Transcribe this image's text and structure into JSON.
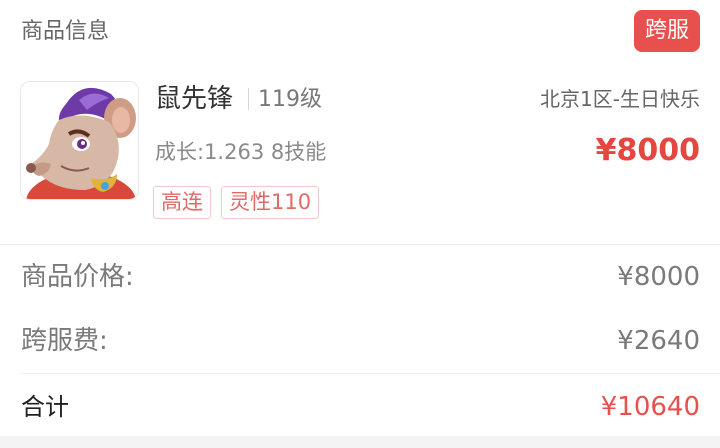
{
  "header": {
    "title": "商品信息",
    "badge": "跨服"
  },
  "item": {
    "image_icon": "rat-character-avatar",
    "name": "鼠先锋",
    "level": "119级",
    "server": "北京1区-生日快乐",
    "growth": "成长:1.263 8技能",
    "price": "¥8000",
    "tags": [
      "高连",
      "灵性110"
    ]
  },
  "summary": {
    "price_label": "商品价格:",
    "price_value": "¥8000",
    "fee_label": "跨服费:",
    "fee_value": "¥2640",
    "total_label": "合计",
    "total_value": "¥10640"
  },
  "colors": {
    "accent": "#e8504d",
    "tag_border": "#f1c8c8",
    "tag_text": "#e06a66"
  }
}
